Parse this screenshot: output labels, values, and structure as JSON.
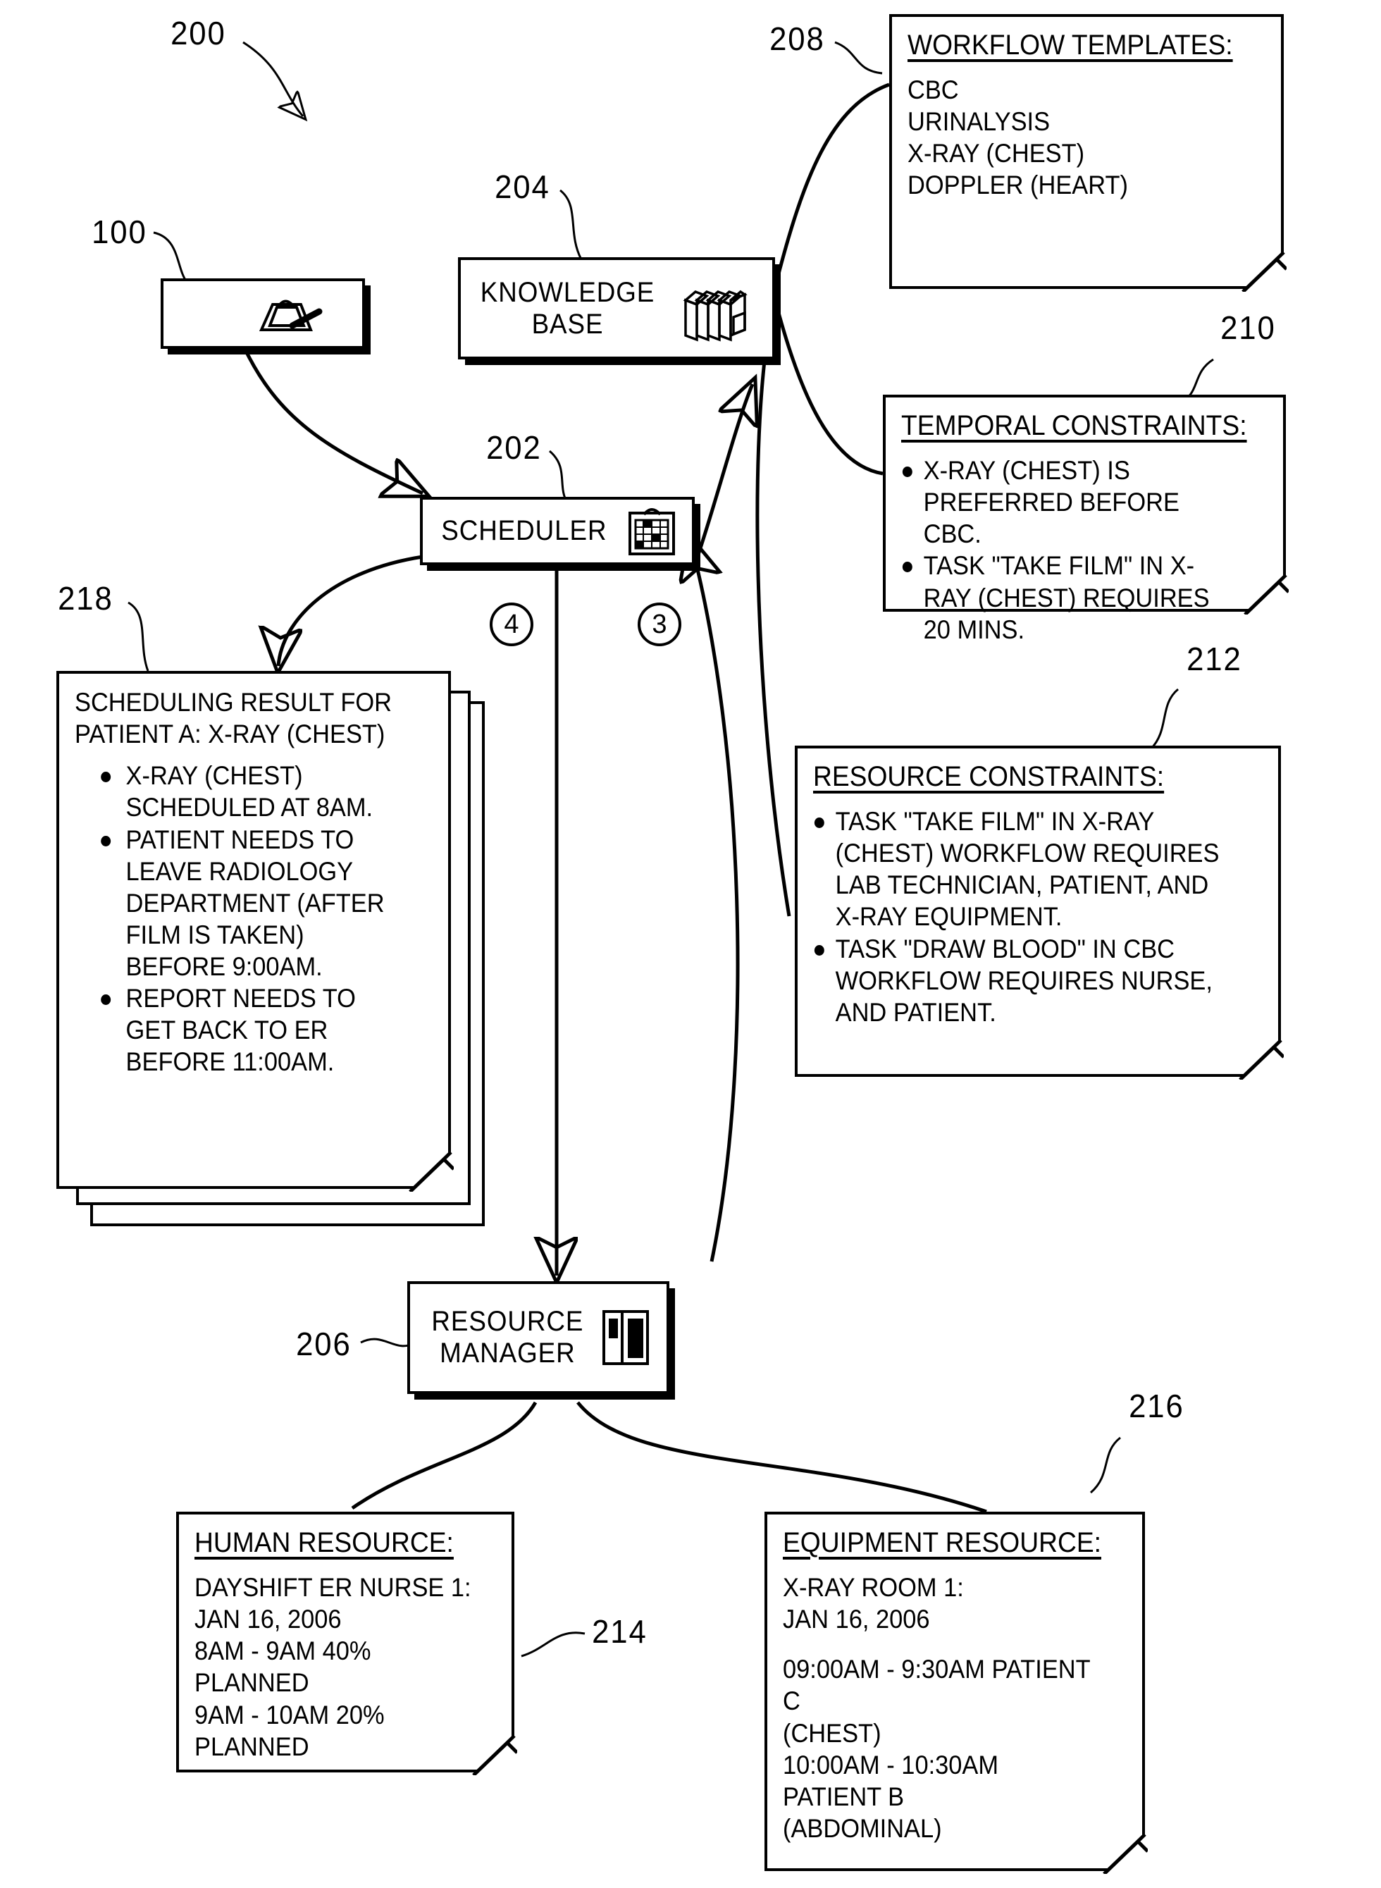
{
  "figure": {
    "number": "200",
    "refs": {
      "system": "200",
      "client": "100",
      "scheduler": "202",
      "knowledge_base": "204",
      "resource_manager": "206",
      "workflow_templates": "208",
      "temporal_constraints": "210",
      "resource_constraints": "212",
      "human_resource": "214",
      "equipment_resource": "216",
      "scheduling_result": "218"
    },
    "steps": {
      "step3": "3",
      "step4": "4"
    }
  },
  "nodes": {
    "client": {
      "label": "",
      "icon": "mouse-click-icon"
    },
    "knowledge_base": {
      "label": "KNOWLEDGE\nBASE",
      "icon": "books-icon"
    },
    "scheduler": {
      "label": "SCHEDULER",
      "icon": "calendar-clipboard-icon"
    },
    "resource_manager": {
      "label": "RESOURCE\nMANAGER",
      "icon": "resource-bars-icon"
    }
  },
  "notes": {
    "workflow_templates": {
      "title": "WORKFLOW TEMPLATES:",
      "lines": [
        "CBC",
        "URINALYSIS",
        "X-RAY (CHEST)",
        "DOPPLER (HEART)"
      ]
    },
    "temporal_constraints": {
      "title": "TEMPORAL CONSTRAINTS:",
      "bullets": [
        "X-RAY (CHEST) IS PREFERRED BEFORE CBC.",
        "TASK \"TAKE FILM\" IN X-RAY (CHEST) REQUIRES 20 MINS."
      ]
    },
    "resource_constraints": {
      "title": "RESOURCE CONSTRAINTS:",
      "bullets": [
        "TASK \"TAKE FILM\" IN X-RAY (CHEST) WORKFLOW REQUIRES LAB TECHNICIAN, PATIENT, AND X-RAY EQUIPMENT.",
        "TASK \"DRAW BLOOD\" IN CBC WORKFLOW REQUIRES NURSE, AND PATIENT."
      ]
    },
    "scheduling_result": {
      "heading": "SCHEDULING RESULT FOR PATIENT A: X-RAY (CHEST)",
      "bullets": [
        "X-RAY (CHEST) SCHEDULED AT 8AM.",
        "PATIENT NEEDS TO LEAVE RADIOLOGY DEPARTMENT (AFTER FILM IS TAKEN) BEFORE 9:00AM.",
        "REPORT NEEDS TO GET BACK TO ER BEFORE 11:00AM."
      ]
    },
    "human_resource": {
      "title": "HUMAN RESOURCE:",
      "lines": [
        "DAYSHIFT ER NURSE 1:",
        "JAN 16, 2006",
        "8AM - 9AM 40% PLANNED",
        "9AM - 10AM 20% PLANNED"
      ]
    },
    "equipment_resource": {
      "title": "EQUIPMENT RESOURCE:",
      "lines_group_a": [
        "X-RAY ROOM 1:",
        "JAN 16, 2006"
      ],
      "lines_group_b": [
        "09:00AM - 9:30AM PATIENT C",
        "(CHEST)",
        "10:00AM - 10:30AM PATIENT B",
        "(ABDOMINAL)"
      ]
    }
  },
  "colors": {
    "ink": "#000000",
    "paper": "#ffffff"
  }
}
